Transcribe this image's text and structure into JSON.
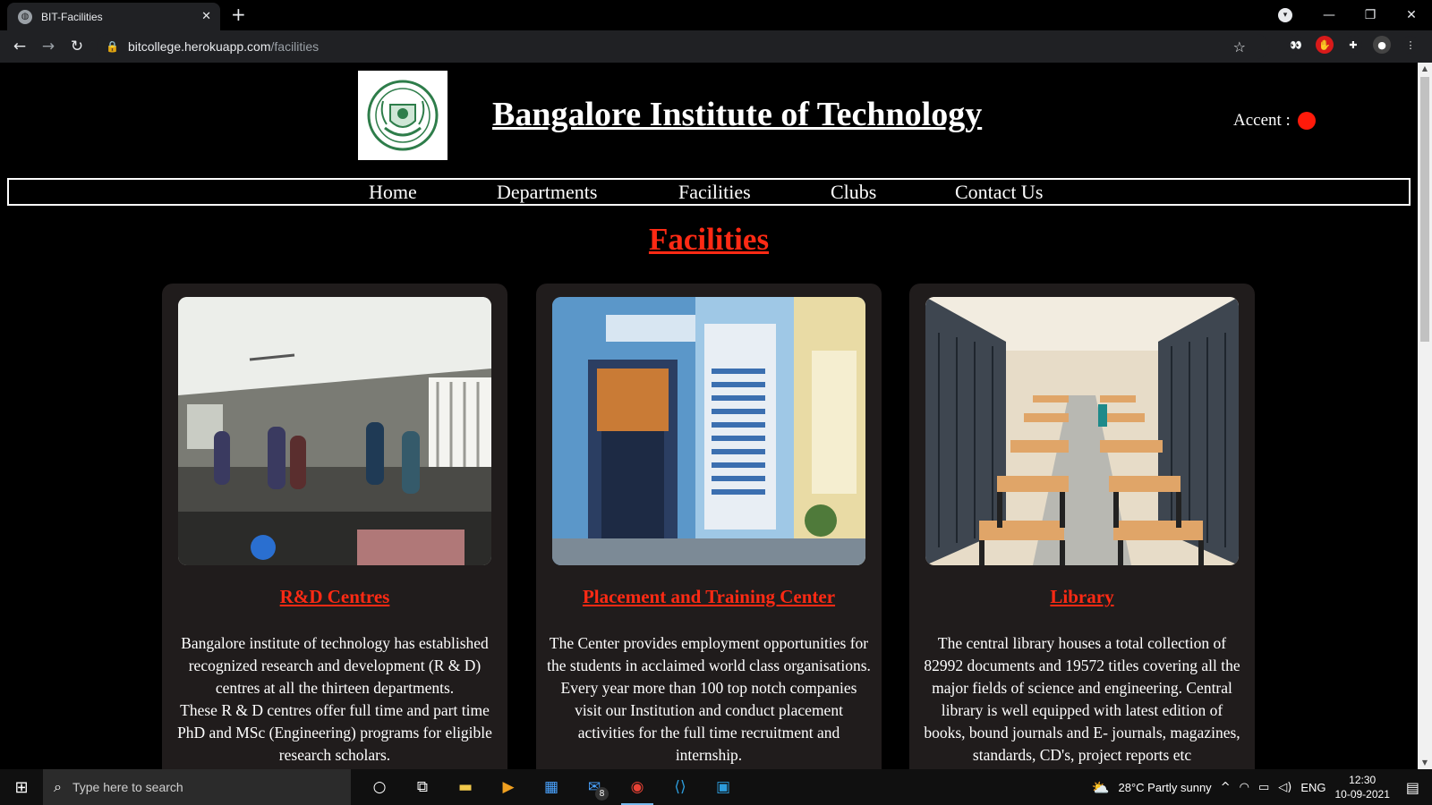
{
  "browser": {
    "tab_title": "BIT-Facilities",
    "url_host": "bitcollege.herokuapp.com",
    "url_path": "/facilities"
  },
  "header": {
    "site_title": "Bangalore Institute of Technology",
    "accent_label": "Accent :",
    "accent_color": "#ff1a0a"
  },
  "nav": {
    "items": [
      "Home",
      "Departments",
      "Facilities",
      "Clubs",
      "Contact Us"
    ]
  },
  "page": {
    "title": "Facilities"
  },
  "cards": [
    {
      "title": "R&D Centres",
      "text": "Bangalore institute of technology has established recognized research and development (R & D) centres at all the thirteen departments.\nThese R & D centres offer full time and part time PhD and MSc (Engineering) programs for eligible research scholars."
    },
    {
      "title": "Placement and Training Center",
      "text": "The Center provides employment opportunities for the students in acclaimed world class organisations. Every year more than 100 top notch companies visit our Institution and conduct placement activities for the full time recruitment and internship."
    },
    {
      "title": "Library",
      "text": "The central library houses a total collection of 82992 documents and 19572 titles covering all the major fields of science and engineering. Central library is well equipped with latest edition of books, bound journals and E- journals, magazines, standards, CD's, project reports etc"
    }
  ],
  "taskbar": {
    "search_placeholder": "Type here to search",
    "mail_badge": "8",
    "weather": "28°C  Partly sunny",
    "language": "ENG",
    "time": "12:30",
    "date": "10-09-2021"
  }
}
